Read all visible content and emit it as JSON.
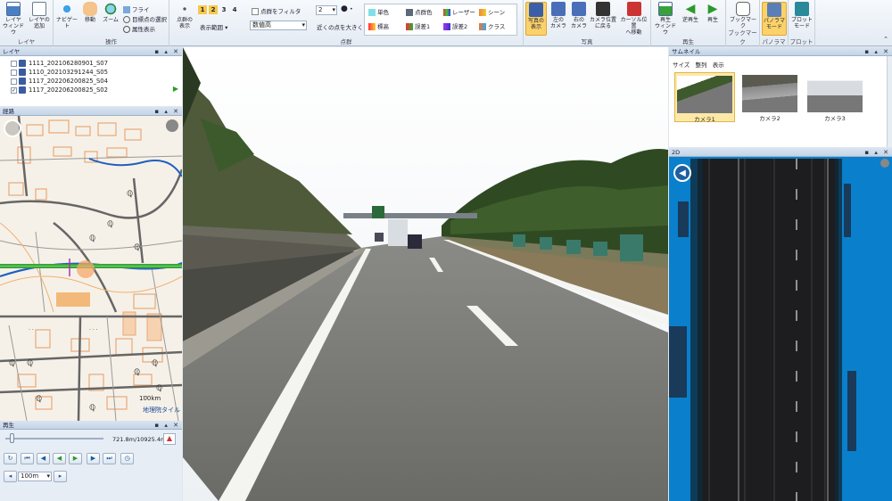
{
  "ribbon": {
    "groups": {
      "layer": "レイヤ",
      "operation": "操作",
      "pointcloud": "点群",
      "photo": "写真",
      "playback": "再生",
      "bookmark": "ブックマーク",
      "panorama": "パノラマ",
      "plot": "プロット"
    },
    "layer_window": "レイヤ\nウィンドウ",
    "add_layer": "レイヤの\n追加",
    "navigate": "ナビゲート",
    "move": "移動",
    "zoom": "ズーム",
    "fly": "フライ",
    "select_target_point": "目標点の選択",
    "attribute_display": "属性表示",
    "show_points": "点群の\n表示",
    "display_range": "表示範囲",
    "num1": "1",
    "num2": "2",
    "num3": "3",
    "num4": "4",
    "filter_points": "点群をフィルタ",
    "elevation_combo": "数値高",
    "point_size_value": "2",
    "enlarge_near": "近くの点を大きく",
    "color_single": "単色",
    "color_pointcloud": "点群色",
    "color_laser": "レーザー",
    "color_scene": "シーン",
    "color_elevation": "標高",
    "color_error1": "誤差1",
    "color_error2": "誤差2",
    "color_class": "クラス",
    "show_photo": "写真の\n表示",
    "left_camera": "左の\nカメラ",
    "right_camera": "右の\nカメラ",
    "return_camera": "カメラ位置\nに戻る",
    "move_cursor": "カーソル位置\nへ移動",
    "playback_window": "再生\nウィンドウ",
    "reverse_play": "逆再生",
    "play": "再生",
    "bookmark_btn": "ブックマーク",
    "panorama_mode": "パノラマ\nモード",
    "plot_mode": "プロット\nモード"
  },
  "layers": {
    "title": "レイヤ",
    "items": [
      {
        "name": "1111_20210628090​1_S07",
        "checked": false
      },
      {
        "name": "1110_202103291244_S05",
        "checked": false
      },
      {
        "name": "1117_202206200825_S04",
        "checked": false
      },
      {
        "name": "1117_202206200825_S02",
        "checked": true
      }
    ]
  },
  "map": {
    "title": "経路",
    "zoom_label": "100km",
    "tile_label": "地理院タイル"
  },
  "playback": {
    "title": "再生",
    "position": "721.8m/10925.4m",
    "step": "100m",
    "progress": 0.066
  },
  "thumbnails": {
    "title": "サムネイル",
    "menu": [
      "サイズ",
      "整列",
      "表示"
    ],
    "items": [
      "カメラ1",
      "カメラ2",
      "カメラ3"
    ],
    "selected": 0
  },
  "pointcloud2d": {
    "title": "2D"
  },
  "colors": {
    "accent": "#fbd26a",
    "panel_title": "#c4d4e6",
    "pc_blue": "#0a7fcc"
  }
}
